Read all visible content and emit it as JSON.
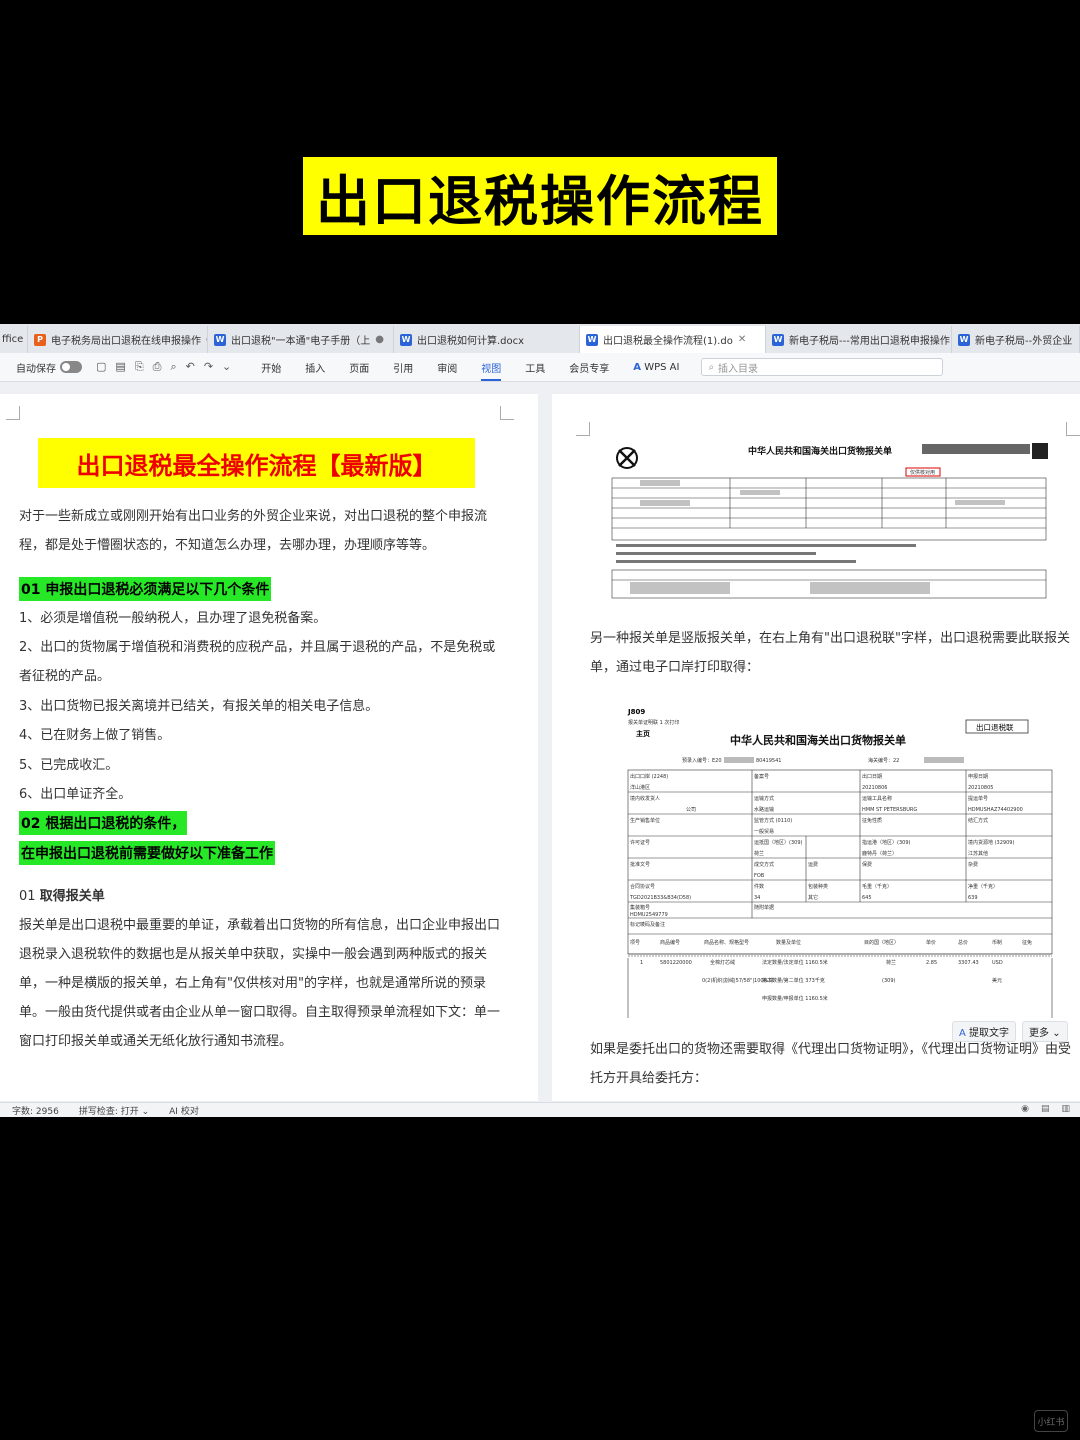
{
  "banner": {
    "title": "出口退税操作流程"
  },
  "tabs": [
    {
      "label": "ffice",
      "icon": "none",
      "active": false
    },
    {
      "label": "电子税务局出口退税在线申报操作",
      "icon": "P",
      "active": false
    },
    {
      "label": "出口退税\"一本通\"电子手册（上",
      "icon": "W",
      "active": false
    },
    {
      "label": "出口退税如何计算.docx",
      "icon": "W",
      "active": false
    },
    {
      "label": "出口退税最全操作流程(1).do",
      "icon": "W",
      "active": true
    },
    {
      "label": "新电子税局---常用出口退税申报操作",
      "icon": "W",
      "active": false
    },
    {
      "label": "新电子税局--外贸企业",
      "icon": "W",
      "active": false
    }
  ],
  "toolbar": {
    "autosave_label": "自动保存",
    "menu": [
      "开始",
      "插入",
      "页面",
      "引用",
      "审阅",
      "视图",
      "工具",
      "会员专享"
    ],
    "active_menu": "视图",
    "wps_ai": "WPS AI",
    "search_placeholder": "插入目录"
  },
  "left_page": {
    "title": "出口退税最全操作流程【最新版】",
    "intro": "对于一些新成立或刚刚开始有出口业务的外贸企业来说，对出口退税的整个申报流程，都是处于懵圈状态的，不知道怎么办理，去哪办理，办理顺序等等。",
    "section1": "01 申报出口退税必须满足以下几个条件",
    "conditions": [
      "1、必须是增值税一般纳税人，且办理了退免税备案。",
      "2、出口的货物属于增值税和消费税的应税产品，并且属于退税的产品，不是免税或者征税的产品。",
      "3、出口货物已报关离境并已结关，有报关单的相关电子信息。",
      "4、已在财务上做了销售。",
      "5、已完成收汇。",
      "6、出口单证齐全。"
    ],
    "section2_line1": "02 根据出口退税的条件，",
    "section2_line2": "在申报出口退税前需要做好以下准备工作",
    "sub_num": "01",
    "sub_title": "取得报关单",
    "body": "报关单是出口退税中最重要的单证，承载着出口货物的所有信息，出口企业申报出口退税录入退税软件的数据也是从报关单中获取，实操中一般会遇到两种版式的报关单，一种是横版的报关单，右上角有\"仅供核对用\"的字样，也就是通常所说的预录单。一般由货代提供或者由企业从单一窗口取得。自主取得预录单流程如下文：单一窗口打印报关单或通关无纸化放行通知书流程。"
  },
  "right_page": {
    "form1_title": "中华人民共和国海关出口货物报关单",
    "form1_stamp": "仅供核对用",
    "para1": "另一种报关单是竖版报关单，在右上角有\"出口退税联\"字样，出口退税需要此联报关单，通过电子口岸打印取得：",
    "form2_code": "J809",
    "form2_sub": "报关单证明联 1 次打印",
    "form2_main": "主页",
    "form2_title": "中华人民共和国海关出口货物报关单",
    "form2_stamp": "出口退税联",
    "form2_pre": "预录入编号：E20",
    "form2_pre_tail": "80419541",
    "form2_customs": "海关编号：22",
    "form2_fields": {
      "port": "出口口岸 (2248)",
      "port_val": "洋山港区",
      "record": "备案号",
      "date": "出口日期",
      "date_val": "20210806",
      "apply": "申报日期",
      "apply_val": "20210805",
      "consignor": "境内收发货人",
      "consignor_val": "公司",
      "transport": "运输方式",
      "transport_val": "水路运输",
      "vessel": "运输工具名称",
      "vessel_val": "HMM ST PETERSBURG",
      "bill": "提运单号",
      "bill_val": "HDMUSHAZ74402900",
      "producer": "生产销售单位",
      "supervise": "监管方式 (0110)",
      "supervise_val": "一般贸易",
      "nature": "征免性质",
      "settle": "结汇方式",
      "license": "许可证号",
      "dest": "运抵国（地区）(309)",
      "dest_val": "荷兰",
      "port_dest": "指运港（地区）(309)",
      "port_dest_val": "鹿特丹（荷兰）",
      "source": "境内货源地 (32909)",
      "source_val": "江苏其他",
      "approve": "批准文号",
      "deal": "成交方式",
      "deal_val": "FOB",
      "freight": "运费",
      "insure": "保费",
      "misc": "杂费",
      "contract": "合同协议号",
      "contract_val": "TGD2021B33&B34(D58)",
      "pieces": "件数",
      "pieces_val": "34",
      "pack": "包装种类",
      "pack_val": "其它",
      "gross": "毛重（千克）",
      "gross_val": "645",
      "net": "净重（千克）",
      "net_val": "639",
      "container": "集装箱号",
      "container_val": "HDMU2549779",
      "attach": "随附单据",
      "mark": "标记唛码及备注"
    },
    "form2_headers": [
      "项号",
      "商品编号",
      "商品名称、规格型号",
      "数量及单位",
      "目的国（地区）",
      "单价",
      "总价",
      "币制",
      "征免"
    ],
    "form2_row": [
      "1",
      "5801220000",
      "全棉灯芯绒",
      "法定数量/法定单位 1160.5米",
      "荷兰",
      "2.85",
      "3307.43",
      "USD",
      ""
    ],
    "form2_row2": [
      "0(2)机织|割绒|57/58\"|100%棉",
      "第二数量/第二单位 373千克",
      "(309)",
      "美元"
    ],
    "form2_row3": "申报数量/申报单位 1160.5米",
    "float_extract": "提取文字",
    "float_more": "更多",
    "para2": "如果是委托出口的货物还需要取得《代理出口货物证明》，《代理出口货物证明》由受托方开具给委托方："
  },
  "status": {
    "word_count": "字数: 2956",
    "spell": "拼写检查: 打开",
    "ai": "AI 校对"
  },
  "watermark": "小红书"
}
